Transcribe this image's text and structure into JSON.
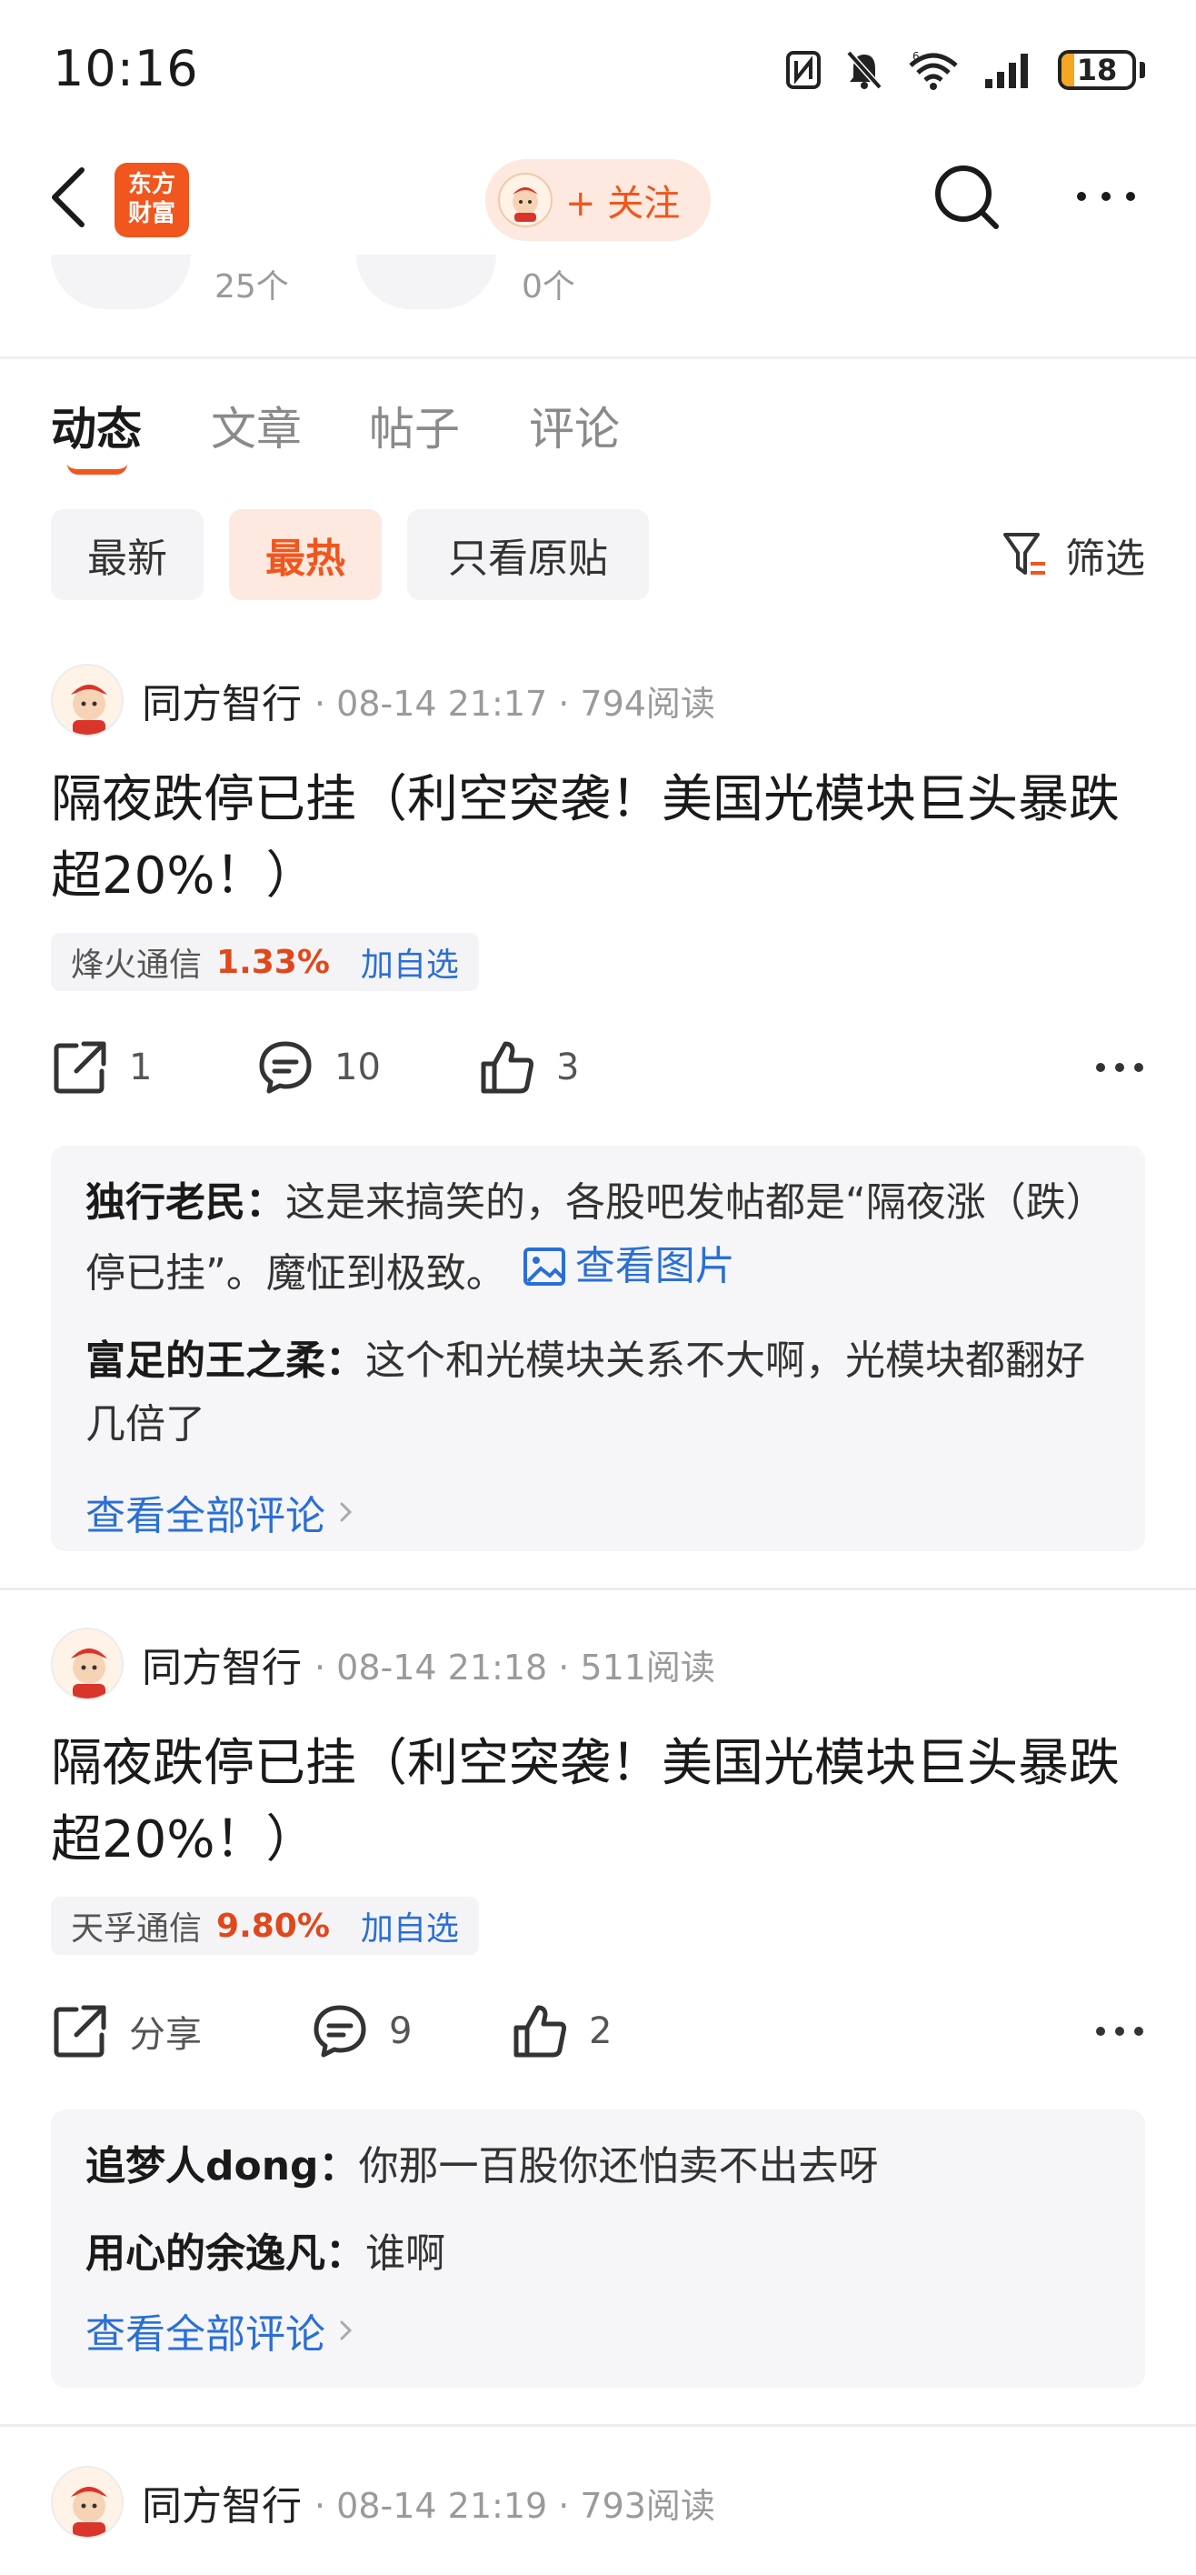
{
  "status_bar": {
    "time": "10:16",
    "battery": "18",
    "battery_level": 0.18,
    "icons": [
      "nfc-icon",
      "mute-bell-icon",
      "wifi-6-icon",
      "signal-icon",
      "battery-icon"
    ]
  },
  "header": {
    "logo_line1": "东方",
    "logo_line2": "财富",
    "follow_label": "+ 关注",
    "icons": [
      "back-arrow-icon",
      "search-icon",
      "more-dots-icon"
    ]
  },
  "stats": {
    "left_count": "25个",
    "right_count": "0个"
  },
  "tabs": [
    {
      "label": "动态",
      "active": true
    },
    {
      "label": "文章",
      "active": false
    },
    {
      "label": "帖子",
      "active": false
    },
    {
      "label": "评论",
      "active": false
    }
  ],
  "filters": {
    "chips": [
      {
        "label": "最新",
        "active": false
      },
      {
        "label": "最热",
        "active": true
      }
    ],
    "original_only": "只看原贴",
    "filter_label": "筛选"
  },
  "posts": [
    {
      "author": "同方智行",
      "meta": "· 08-14 21:17 · 794阅读",
      "title": "隔夜跌停已挂（利空突袭！美国光模块巨头暴跌超20%！）",
      "stock": {
        "name": "烽火通信",
        "pct": "1.33%",
        "add": "加自选"
      },
      "actions": {
        "share": "1",
        "comment": "10",
        "like": "3"
      },
      "comments": [
        {
          "user": "独行老民：",
          "text": "这是来搞笑的，各股吧发帖都是“隔夜涨（跌）停已挂”。魔怔到极致。",
          "view_image": "查看图片"
        },
        {
          "user": "富足的王之柔：",
          "text": "这个和光模块关系不大啊，光模块都翻好几倍了"
        }
      ],
      "view_all": "查看全部评论"
    },
    {
      "author": "同方智行",
      "meta": "· 08-14 21:18 · 511阅读",
      "title": "隔夜跌停已挂（利空突袭！美国光模块巨头暴跌超20%！）",
      "stock": {
        "name": "天孚通信",
        "pct": "9.80%",
        "add": "加自选"
      },
      "actions": {
        "share": "分享",
        "comment": "9",
        "like": "2"
      },
      "comments": [
        {
          "user": "追梦人dong：",
          "text": "你那一百股你还怕卖不出去呀"
        },
        {
          "user": "用心的余逸凡：",
          "text": "谁啊"
        }
      ],
      "view_all": "查看全部评论"
    },
    {
      "author": "同方智行",
      "meta": "· 08-14 21:19 · 793阅读"
    }
  ],
  "colors": {
    "accent": "#f0561d",
    "link": "#2a6fd6",
    "up": "#e0481c"
  }
}
